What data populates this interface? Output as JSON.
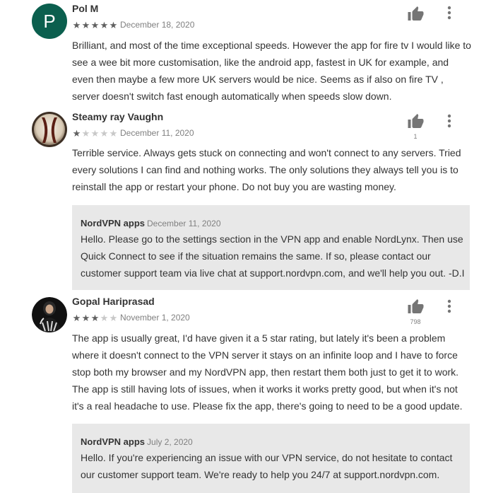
{
  "reviews": [
    {
      "author": "Pol M",
      "avatar_letter": "P",
      "rating": 5,
      "date": "December 18, 2020",
      "helpful_count": "",
      "text": "Brilliant, and most of the time exceptional speeds. However the app for fire tv I would like to see a wee bit more customisation, like the android app, fastest in UK for example, and even then maybe a few more UK servers would be nice. Seems as if also on fire TV , server doesn't switch fast enough automatically when speeds slow down."
    },
    {
      "author": "Steamy ray Vaughn",
      "rating": 1,
      "date": "December 11, 2020",
      "helpful_count": "1",
      "text": "Terrible service. Always gets stuck on connecting and won't connect to any servers. Tried every solutions I can find and nothing works. The only solutions they always tell you is to reinstall the app or restart your phone. Do not buy you are wasting money.",
      "reply": {
        "author": "NordVPN apps",
        "date": "December 11, 2020",
        "text": "Hello. Please go to the settings section in the VPN app and enable NordLynx. Then use Quick Connect to see if the situation remains the same. If so, please contact our customer support team via live chat at support.nordvpn.com, and we'll help you out. -D.I"
      }
    },
    {
      "author": "Gopal Hariprasad",
      "rating": 3,
      "date": "November 1, 2020",
      "helpful_count": "798",
      "text": "The app is usually great, I'd have given it a 5 star rating, but lately it's been a problem where it doesn't connect to the VPN server it stays on an infinite loop and I have to force stop both my browser and my NordVPN app, then restart them both just to get it to work. The app is still having lots of issues, when it works it works pretty good, but when it's not it's a real headache to use. Please fix the app, there's going to need to be a good update.",
      "reply": {
        "author": "NordVPN apps",
        "date": "July 2, 2020",
        "text": "Hello. If you're experiencing an issue with our VPN service, do not hesitate to contact our customer support team. We're ready to help you 24/7 at support.nordvpn.com."
      }
    }
  ],
  "icons": {
    "helpful": "thumb-up-icon",
    "more": "more-vert-icon"
  },
  "colors": {
    "avatar_letter_bg": "#0b5f4e",
    "reply_bg": "#e8e8e8",
    "star_on": "#5f5f5f",
    "star_off": "#c8c8c8"
  }
}
